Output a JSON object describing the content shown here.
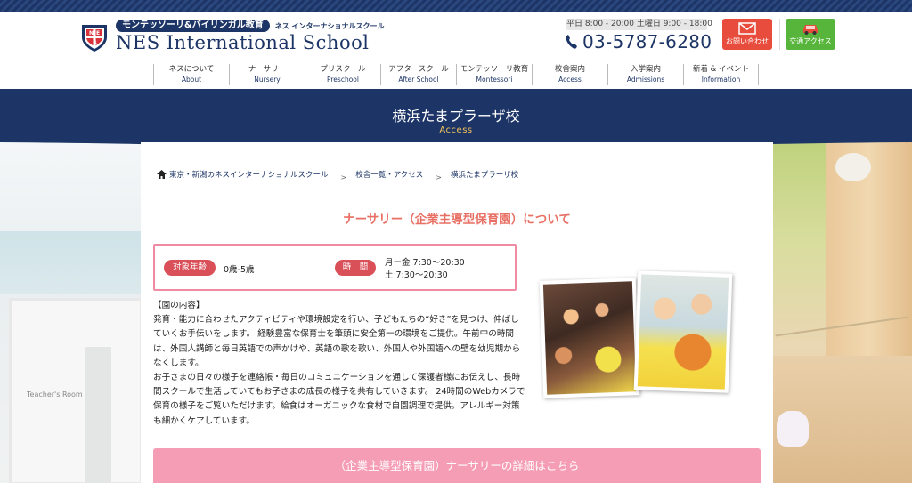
{
  "header": {
    "logo_tag": "モンテッソーリ&バイリンガル教育",
    "logo_sub": "ネス インターナショナルスクール",
    "logo_name": "NES International School",
    "hours": "平日 8:00 - 20:00  土曜日 9:00 - 18:00",
    "phone": "03-5787-6280",
    "contact_label": "お問い合わせ",
    "access_label": "交通アクセス"
  },
  "nav": [
    {
      "jp": "ネスについて",
      "en": "About"
    },
    {
      "jp": "ナーサリー",
      "en": "Nursery"
    },
    {
      "jp": "プリスクール",
      "en": "Preschool"
    },
    {
      "jp": "アフタースクール",
      "en": "After School"
    },
    {
      "jp": "モンテッソーリ教育",
      "en": "Montessori"
    },
    {
      "jp": "校舎案内",
      "en": "Access"
    },
    {
      "jp": "入学案内",
      "en": "Admissions"
    },
    {
      "jp": "新着 & イベント",
      "en": "Information"
    }
  ],
  "banner": {
    "title": "横浜たまプラーザ校",
    "subtitle": "Access"
  },
  "breadcrumb": [
    "東京・新潟のネスインターナショナルスクール",
    "校舎一覧・アクセス",
    "横浜たまプラーザ校"
  ],
  "breadcrumb_sep": ">",
  "section": {
    "title": "ナーサリー（企業主導型保育園）について"
  },
  "info": {
    "age_label": "対象年齢",
    "age_value": "0歳-5歳",
    "time_label": "時　間",
    "time_weekday": "月ー金 7:30〜20:30",
    "time_saturday": "土 7:30〜20:30"
  },
  "body": {
    "heading": "【園の内容】",
    "para1": "発育・能力に合わせたアクティビティや環境設定を行い、子どもたちの“好き”を見つけ、伸ばしていくお手伝いをします。 経験豊富な保育士を筆頭に安全第一の環境をご提供。午前中の時間は、外国人講師と毎日英語での声かけや、英語の歌を歌い、外国人や外国語への壁を幼児期からなくします。",
    "para2": "お子さまの日々の様子を連絡帳・毎日のコミュニケーションを通して保護者様にお伝えし、長時間スクールで生活していてもお子さまの成長の様子を共有していきます。 24時間のWebカメラで保育の様子をご覧いただけます。給食はオーガニックな食材で自園調理で提供。アレルギー対策も細かくケアしています。"
  },
  "background": {
    "door_label": "Teacher's Room"
  },
  "cta": {
    "label": "（企業主導型保育園）ナーサリーの詳細はこちら"
  },
  "colors": {
    "navy": "#1d3566",
    "accent_red": "#e86f63",
    "pill_red": "#d95058",
    "pink": "#f59db5",
    "contact_red": "#e84c3d",
    "access_green": "#56b53a",
    "gold": "#f3c25a"
  }
}
